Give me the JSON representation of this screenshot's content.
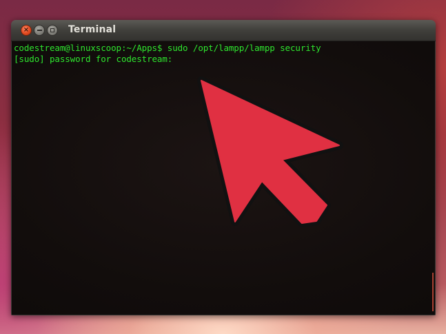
{
  "window": {
    "title": "Terminal"
  },
  "terminal": {
    "lines": [
      "codestream@linuxscoop:~/Apps$ sudo /opt/lampp/lampp security",
      "[sudo] password for codestream:"
    ],
    "text_color": "#2ee62e"
  },
  "controls": {
    "close_icon": "close-icon",
    "minimize_icon": "minimize-icon",
    "maximize_icon": "maximize-icon"
  },
  "overlay": {
    "arrow_color": "#e03042",
    "arrow_icon": "pointer-arrow-icon"
  }
}
